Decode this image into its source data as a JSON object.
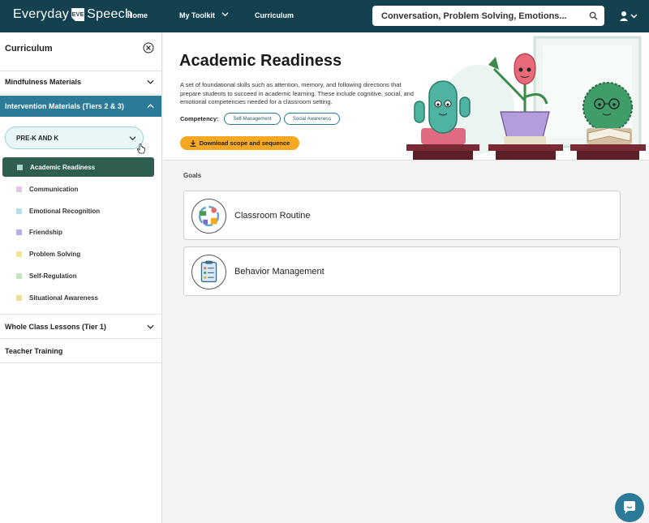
{
  "header": {
    "logo_left": "Everyday",
    "logo_badge": "EVE",
    "logo_right": "Speech",
    "nav": {
      "home": "Home",
      "toolkit": "My Toolkit",
      "curriculum": "Curriculum"
    },
    "search_placeholder": "Conversation, Problem Solving, Emotions..."
  },
  "sidebar": {
    "title": "Curriculum",
    "sections": {
      "mindfulness": "Mindfulness Materials",
      "intervention": "Intervention Materials (Tiers 2 & 3)",
      "whole_class": "Whole Class Lessons (Tier 1)",
      "teacher_training": "Teacher Training"
    },
    "grade_selected": "PRE-K AND K",
    "categories": [
      {
        "label": "Academic Readiness",
        "color": "#a8d8cf"
      },
      {
        "label": "Communication",
        "color": "#e0c7e4"
      },
      {
        "label": "Emotional Recognition",
        "color": "#b8dcea"
      },
      {
        "label": "Friendship",
        "color": "#b6aee4"
      },
      {
        "label": "Problem Solving",
        "color": "#ece79c"
      },
      {
        "label": "Self-Regulation",
        "color": "#c4e6c0"
      },
      {
        "label": "Situational Awareness",
        "color": "#ebe09b"
      }
    ]
  },
  "hero": {
    "title": "Academic Readiness",
    "description": "A set of foundational skills such as attention, memory, and following directions that prepare students to succeed in academic learning. These include cognitive, social, and emotional competencies needed for a classroom setting.",
    "competency_label": "Competency:",
    "competencies": [
      "Self-Management",
      "Social Awareness"
    ],
    "download_label": "Download scope and sequence"
  },
  "goals": {
    "label": "Goals",
    "items": [
      "Classroom Routine",
      "Behavior Management"
    ]
  },
  "colors": {
    "nav_bg": "#14414f",
    "accent_teal": "#2a7a98",
    "active_category": "#2e5e4f",
    "download_orange": "#f6a823"
  }
}
